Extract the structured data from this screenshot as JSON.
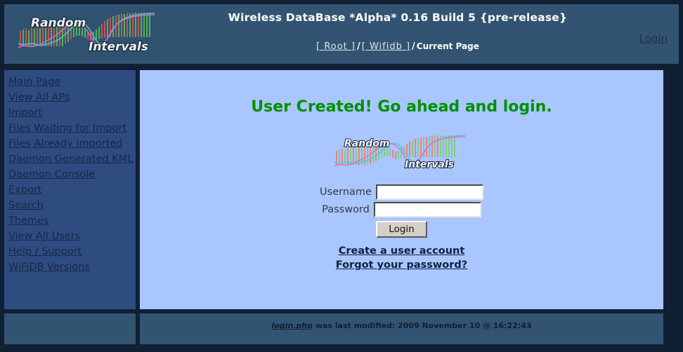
{
  "header": {
    "title": "Wireless DataBase *Alpha* 0.16 Build 5 {pre-release}",
    "logo_alt": "Random Intervals",
    "logo_word_top": "Random",
    "logo_word_bottom": "Intervals",
    "login_link": "Login",
    "breadcrumb": {
      "root": "[ Root ]",
      "section": "[ Wifidb ]",
      "separator": "/",
      "current": "Current Page"
    }
  },
  "sidebar": {
    "items": [
      {
        "label": "Main Page"
      },
      {
        "label": "View All APs"
      },
      {
        "label": "Import"
      },
      {
        "label": "Files Waiting for Import"
      },
      {
        "label": "Files Already Imported"
      },
      {
        "label": "Daemon Generated KML"
      },
      {
        "label": "Daemon Console"
      },
      {
        "label": "Export"
      },
      {
        "label": "Search"
      },
      {
        "label": "Themes"
      },
      {
        "label": "View All Users"
      },
      {
        "label": "Help / Support"
      },
      {
        "label": "WiFiDB Versions"
      }
    ]
  },
  "main": {
    "message": "User Created! Go ahead and login.",
    "logo_word_top": "Random",
    "logo_word_bottom": "Intervals",
    "form": {
      "username_label": "Username",
      "username_value": "",
      "password_label": "Password",
      "password_value": "",
      "submit_label": "Login"
    },
    "links": {
      "create_account": "Create a user account",
      "forgot_password": "Forgot your password?"
    }
  },
  "footer": {
    "file_link": "login.php",
    "text": " was last modified: 2009 November 10 @ 16:22:43"
  },
  "colors": {
    "page_background": "#101f33",
    "panel_blue": "#325472",
    "sidebar_blue": "#2f4c80",
    "content_blue": "#aac6ff",
    "success_green": "#009000",
    "link_dark": "#142848"
  }
}
